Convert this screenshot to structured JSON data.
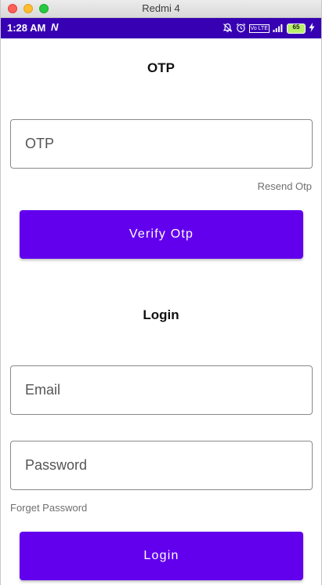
{
  "window": {
    "title": "Redmi 4"
  },
  "status_bar": {
    "time": "1:28 AM",
    "notification_icon": "N",
    "icons": [
      "mute-bell-icon",
      "alarm-icon",
      "volte-icon",
      "signal-icon",
      "battery-icon",
      "charging-icon"
    ],
    "volte_label": "Vo LTE",
    "battery_level": "65",
    "color": "#3700b3"
  },
  "otp_section": {
    "title": "OTP",
    "otp_field": {
      "placeholder": "OTP",
      "value": ""
    },
    "resend_label": "Resend Otp",
    "verify_button_label": "Verify Otp"
  },
  "login_section": {
    "title": "Login",
    "email_field": {
      "placeholder": "Email",
      "value": ""
    },
    "password_field": {
      "placeholder": "Password",
      "value": ""
    },
    "forget_password_label": "Forget Password",
    "login_button_label": "Login"
  },
  "colors": {
    "accent": "#6200ee",
    "status_bar": "#3700b3"
  }
}
